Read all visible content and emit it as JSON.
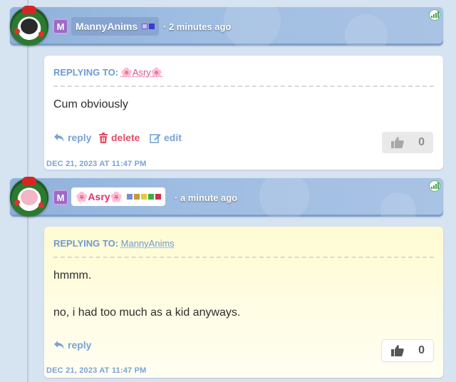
{
  "comments": [
    {
      "username": "MannyAnims",
      "rank_badge": "M",
      "time_ago": "· 2 minutes ago",
      "replying_label": "REPLYING TO:",
      "replying_to": "🌸Asry🌸",
      "body_lines": [
        "Cum obviously"
      ],
      "actions": {
        "reply": "reply",
        "delete": "delete",
        "edit": "edit"
      },
      "likes": "0",
      "timestamp": "DEC 21, 2023 AT 11:47 PM",
      "color_squares": [
        "#c9c3ff",
        "#3a3ad6"
      ]
    },
    {
      "username": "🌸Asry🌸",
      "rank_badge": "M",
      "time_ago": "· a minute ago",
      "replying_label": "REPLYING TO:",
      "replying_to": "MannyAnims",
      "body_lines": [
        "hmmm.",
        "no, i had too much as a kid anyways."
      ],
      "actions": {
        "reply": "reply"
      },
      "likes": "0",
      "timestamp": "DEC 21, 2023 AT 11:47 PM",
      "color_squares": [
        "#7a8bd6",
        "#c69a3a",
        "#e6c93a",
        "#3ab04a",
        "#d0304a"
      ]
    }
  ],
  "colors": {
    "accent_blue": "#7aa3d6",
    "delete_red": "#e0506a",
    "badge_purple": "#9b6bc7"
  },
  "icons": {
    "reply": "reply-arrow-icon",
    "delete": "trash-icon",
    "edit": "pencil-edit-icon",
    "like": "thumbs-up-icon",
    "status": "signal-bars-icon"
  }
}
